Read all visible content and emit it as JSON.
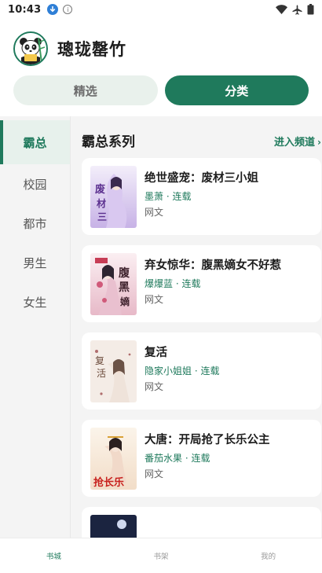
{
  "status": {
    "time": "10:43"
  },
  "header": {
    "title": "璁珑罄竹"
  },
  "top_tabs": [
    {
      "label": "精选",
      "active": false
    },
    {
      "label": "分类",
      "active": true
    }
  ],
  "sidebar": {
    "items": [
      {
        "label": "霸总",
        "active": true
      },
      {
        "label": "校园",
        "active": false
      },
      {
        "label": "都市",
        "active": false
      },
      {
        "label": "男生",
        "active": false
      },
      {
        "label": "女生",
        "active": false
      }
    ]
  },
  "section": {
    "title": "霸总系列",
    "enter_label": "进入频道",
    "enter_arrow": "›"
  },
  "books": [
    {
      "title": "绝世盛宠：废材三小姐",
      "meta": "墨萧 · 连载",
      "genre": "网文",
      "cover_text": "废材三小姐"
    },
    {
      "title": "弃女惊华：腹黑嫡女不好惹",
      "meta": "爆爆蓝 · 连载",
      "genre": "网文",
      "cover_text": "腹黑嫡女"
    },
    {
      "title": "复活",
      "meta": "隐家小姐姐 · 连载",
      "genre": "网文",
      "cover_text": "复活"
    },
    {
      "title": "大唐：开局抢了长乐公主",
      "meta": "番茄水果 · 连载",
      "genre": "网文",
      "cover_text": "抢长乐"
    }
  ],
  "bottom_nav": [
    {
      "label": "书城",
      "active": true
    },
    {
      "label": "书架",
      "active": false
    },
    {
      "label": "我的",
      "active": false
    }
  ],
  "colors": {
    "accent": "#1f7a5c",
    "accent_light": "#e7f1ec",
    "background": "#f4f4f4"
  },
  "icons": [
    "download-icon",
    "info-icon",
    "wifi-icon",
    "airplane-icon",
    "battery-icon",
    "panda-avatar-icon"
  ]
}
